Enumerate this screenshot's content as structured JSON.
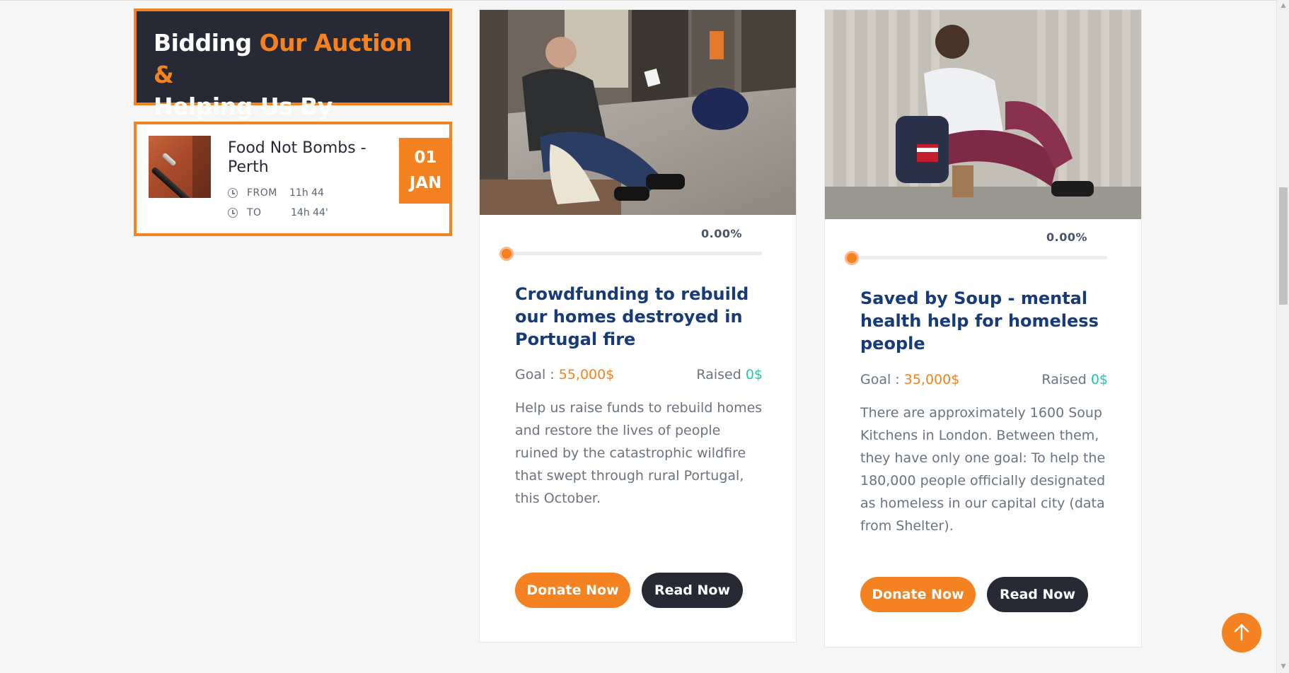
{
  "auction": {
    "title_part1": "Bidding ",
    "title_accent": "Our Auction &",
    "title_part2": "Helping Us By Donation"
  },
  "event": {
    "title": "Food Not Bombs - Perth",
    "from_label": "FROM",
    "from_value": "11h 44",
    "to_label": "TO",
    "to_value": "14h 44'",
    "date_day": "01",
    "date_month": "JAN"
  },
  "campaigns": [
    {
      "progress_label": "0.00%",
      "progress_fraction": 0.0,
      "title": "Crowdfunding to rebuild our homes destroyed in Portugal fire",
      "goal_label": "Goal : ",
      "goal_amount": "55,000$",
      "raised_label": "Raised ",
      "raised_amount": "0$",
      "description": "Help us raise funds to rebuild homes and restore the lives of people ruined by the catastrophic wildfire that swept through rural Portugal, this October.",
      "donate_label": "Donate Now",
      "read_label": "Read Now"
    },
    {
      "progress_label": "0.00%",
      "progress_fraction": 0.0,
      "title": "Saved by Soup - mental health help for homeless people",
      "goal_label": "Goal : ",
      "goal_amount": "35,000$",
      "raised_label": "Raised ",
      "raised_amount": "0$",
      "description": "There are approximately 1600 Soup Kitchens in London. Between them, they have only one goal: To help the 180,000 people officially designated as homeless in our capital city (data from Shelter).",
      "donate_label": "Donate Now",
      "read_label": "Read Now"
    }
  ],
  "colors": {
    "accent": "#f58220",
    "dark": "#272a35",
    "title_blue": "#163a7a",
    "raised_green": "#20c9a6"
  },
  "icons": {
    "clock": "clock-icon",
    "back_to_top": "arrow-up-icon"
  }
}
